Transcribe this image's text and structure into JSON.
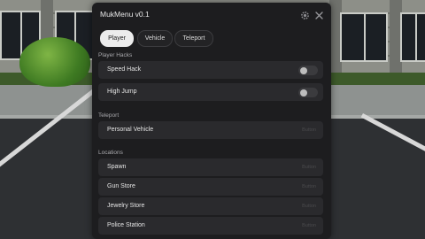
{
  "window": {
    "title": "MukMenu v0.1"
  },
  "tabs": [
    {
      "label": "Player",
      "active": true
    },
    {
      "label": "Vehicle",
      "active": false
    },
    {
      "label": "Teleport",
      "active": false
    }
  ],
  "sections": {
    "player_hacks": {
      "title": "Player Hacks",
      "items": [
        {
          "label": "Speed Hack",
          "enabled": false
        },
        {
          "label": "High Jump",
          "enabled": false
        }
      ]
    },
    "teleport": {
      "title": "Teleport",
      "items": [
        {
          "label": "Personal Vehicle",
          "hint": "Button"
        }
      ]
    },
    "locations": {
      "title": "Locations",
      "items": [
        {
          "label": "Spawn",
          "hint": "Button"
        },
        {
          "label": "Gun Store",
          "hint": "Button"
        },
        {
          "label": "Jewelry Store",
          "hint": "Button"
        },
        {
          "label": "Police Station",
          "hint": "Button"
        }
      ]
    }
  },
  "icons": {
    "settings": "gear-icon",
    "close": "close-icon"
  },
  "colors": {
    "panel_bg": "#1d1d1f",
    "row_bg": "#2a2a2d",
    "active_tab": "#ececec"
  }
}
